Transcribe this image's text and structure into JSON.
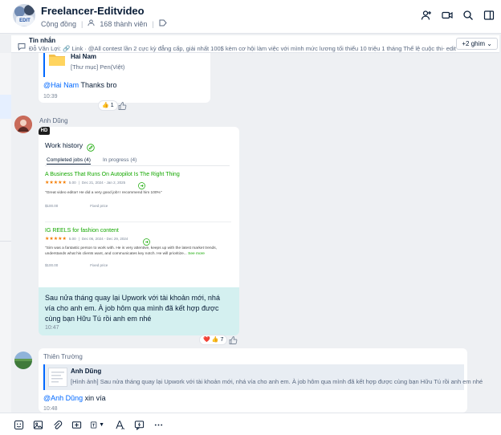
{
  "header": {
    "title": "Freelancer-Editvideo",
    "type_label": "Cộng đồng",
    "member_count": "168 thành viên",
    "avatar_label": "EDIT"
  },
  "pinned": {
    "label": "Tin nhắn",
    "text": "Đỗ Văn Lợi: 🔗 Link · @All contest lần 2 cực kỳ đẳng cấp, giải nhất 100$ kèm cơ hội làm việc với mình mức lương tối thiểu 10 triệu 1 tháng Thể lệ cuộc thi- edit vid...",
    "more_button": "+2 ghim"
  },
  "messages": {
    "m1": {
      "quoted_name": "Hai Nam",
      "quoted_type": "[Thư mục] Pen(Việt)",
      "mention": "@Hai Nam",
      "text": " Thanks bro",
      "time": "10:39",
      "reaction_count": "1"
    },
    "m2": {
      "sender": "Anh Dũng",
      "image": {
        "badge": "HD",
        "title": "Work history",
        "tab_completed": "Completed jobs (4)",
        "tab_progress": "In progress (4)",
        "job1": {
          "title": "A Business That Runs On Autopilot Is The Right Thing",
          "stars": "★★★★★",
          "rating": "5.00",
          "dates": "Dec 21, 2024 - Jan 2, 2025",
          "quote": "\"Great video editor! He did a very good job! I recommend him 100%\"",
          "price": "$100.00",
          "price_type": "Fixed price"
        },
        "job2": {
          "title": "IG REELS for fashion content",
          "stars": "★★★★★",
          "rating": "5.00",
          "dates": "Dec 06, 2024 - Dec 29, 2024",
          "quote": "\"Sim was a fantastic person to work with. He is very attentive, keeps up with the latest market trends, understands what his clients want, and communicates key notch. He will prioritize...",
          "more": "See more",
          "price": "$100.00",
          "price_type": "Fixed price"
        }
      },
      "text": "Sau nửa tháng quay lại Upwork với tài khoản mới, nhá vía cho anh em. À job hôm qua mình đã kết hợp được cùng bạn Hữu Tú rồi anh em nhé",
      "time": "10:47",
      "reaction_count": "7"
    },
    "m3": {
      "sender": "Thiên Trường",
      "quoted_name": "Anh Dũng",
      "quoted_text": "[Hình ảnh] Sau nửa tháng quay lại Upwork với tài khoản mới, nhá vía cho anh em. À job hôm qua mình đã kết hợp được cùng bạn Hữu Tú rồi anh em nhé",
      "mention": "@Anh Dũng",
      "text": " xin vía",
      "time": "10:48"
    }
  }
}
